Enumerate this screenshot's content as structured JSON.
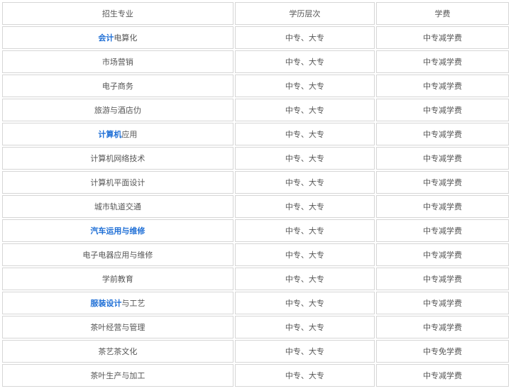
{
  "table": {
    "headers": [
      "招生专业",
      "学历层次",
      "学费"
    ],
    "rows": [
      {
        "major_link": "会计",
        "major_rest": "电算化",
        "level": "中专、大专",
        "fee": "中专减学费"
      },
      {
        "major_link": "",
        "major_rest": "市场营销",
        "level": "中专、大专",
        "fee": "中专减学费"
      },
      {
        "major_link": "",
        "major_rest": "电子商务",
        "level": "中专、大专",
        "fee": "中专减学费"
      },
      {
        "major_link": "",
        "major_rest": "旅游与酒店仂",
        "level": "中专、大专",
        "fee": "中专减学费"
      },
      {
        "major_link": "计算机",
        "major_rest": "应用",
        "level": "中专、大专",
        "fee": "中专减学费"
      },
      {
        "major_link": "",
        "major_rest": "计算机网络技术",
        "level": "中专、大专",
        "fee": "中专减学费"
      },
      {
        "major_link": "",
        "major_rest": "计算机平面设计",
        "level": "中专、大专",
        "fee": "中专减学费"
      },
      {
        "major_link": "",
        "major_rest": "城市轨道交通",
        "level": "中专、大专",
        "fee": "中专减学费"
      },
      {
        "major_link": "汽车运用与维修",
        "major_rest": "",
        "level": "中专、大专",
        "fee": "中专减学费"
      },
      {
        "major_link": "",
        "major_rest": "电子电器应用与维修",
        "level": "中专、大专",
        "fee": "中专减学费"
      },
      {
        "major_link": "",
        "major_rest": "学前教育",
        "level": "中专、大专",
        "fee": "中专减学费"
      },
      {
        "major_link": "服装设计",
        "major_rest": "与工艺",
        "level": "中专、大专",
        "fee": "中专减学费"
      },
      {
        "major_link": "",
        "major_rest": "茶叶经营与管理",
        "level": "中专、大专",
        "fee": "中专减学费"
      },
      {
        "major_link": "",
        "major_rest": "茶艺茶文化",
        "level": "中专、大专",
        "fee": "中专免学费"
      },
      {
        "major_link": "",
        "major_rest": "茶叶生产与加工",
        "level": "中专、大专",
        "fee": "中专减学费"
      }
    ]
  },
  "colors": {
    "link": "#1f6fd6",
    "text": "#555555",
    "border": "#d6d6d6"
  }
}
